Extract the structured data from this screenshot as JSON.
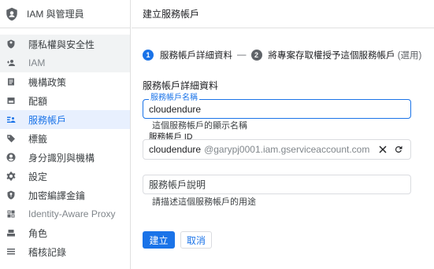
{
  "sidebar": {
    "title": "IAM 與管理員",
    "items": [
      {
        "label": "隱私權與安全性",
        "icon": "shield-icon"
      },
      {
        "label": "IAM",
        "icon": "person-add-icon"
      },
      {
        "label": "機構政策",
        "icon": "policy-doc-icon"
      },
      {
        "label": "配額",
        "icon": "quota-icon"
      },
      {
        "label": "服務帳戶",
        "icon": "service-account-icon"
      },
      {
        "label": "標籤",
        "icon": "label-tag-icon"
      },
      {
        "label": "身分識別與機構",
        "icon": "account-circle-icon"
      },
      {
        "label": "設定",
        "icon": "settings-gear-icon"
      },
      {
        "label": "加密編譯金鑰",
        "icon": "key-shield-icon"
      },
      {
        "label": "Identity-Aware Proxy",
        "icon": "proxy-icon"
      },
      {
        "label": "角色",
        "icon": "roles-icon"
      },
      {
        "label": "稽核記錄",
        "icon": "audit-log-icon"
      }
    ]
  },
  "header": {
    "title": "建立服務帳戶"
  },
  "stepper": {
    "step1_num": "1",
    "step1_label": "服務帳戶詳細資料",
    "separator": "—",
    "step2_num": "2",
    "step2_label": "將專案存取權授予這個服務帳戶",
    "step2_optional": "(選用)"
  },
  "form": {
    "section_title": "服務帳戶詳細資料",
    "name_label": "服務帳戶名稱",
    "name_value": "cloudendure",
    "name_hint": "這個服務帳戶的顯示名稱",
    "id_label": "服務帳戶 ID",
    "id_value": "cloudendure",
    "id_suffix": "@garypj0001.iam.gserviceaccount.com",
    "desc_placeholder": "服務帳戶說明",
    "desc_hint": "請描述這個服務帳戶的用途"
  },
  "actions": {
    "create_label": "建立",
    "cancel_label": "取消"
  },
  "colors": {
    "accent": "#1a73e8",
    "active_bg": "#e8f0fe"
  }
}
